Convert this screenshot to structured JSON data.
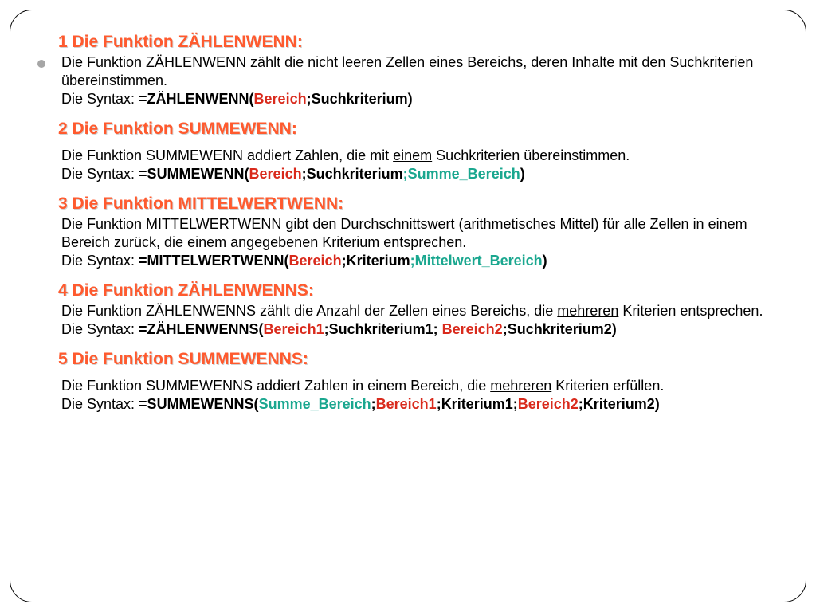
{
  "sections": [
    {
      "heading": "1 Die Funktion ZÄHLENWENN:",
      "desc_pre": "Die Funktion ZÄHLENWENN zählt die nicht leeren Zellen eines Bereichs,  deren Inhalte mit den Suchkriterien übereinstimmen.",
      "syntax_label": "Die Syntax: ",
      "syntax_lead": "=ZÄHLENWENN(",
      "p1": "Bereich",
      "sep1": ";",
      "p2": "Suchkriterium)",
      "tail": ""
    },
    {
      "heading": "2 Die Funktion SUMMEWENN:",
      "desc_pre": "Die Funktion SUMMEWENN addiert Zahlen, die mit ",
      "desc_u": "einem",
      "desc_post": " Suchkriterien übereinstimmen.",
      "syntax_label": "Die Syntax: ",
      "syntax_lead": "=SUMMEWENN(",
      "p1": "Bereich",
      "sep1": ";",
      "p2": "Suchkriterium",
      "sep2": ";",
      "p3": "Summe_Bereich",
      "tail": ")"
    },
    {
      "heading": "3 Die Funktion MITTELWERTWENN:",
      "desc_pre": "Die Funktion MITTELWERTWENN gibt den Durchschnittswert (arithmetisches Mittel) für alle Zellen in einem Bereich zurück, die einem angegebenen Kriterium entsprechen.",
      "syntax_label": "Die Syntax: ",
      "syntax_lead": "=MITTELWERTWENN(",
      "p1": "Bereich",
      "sep1": ";",
      "p2": "Kriterium",
      "sep2": ";",
      "p3": "Mittelwert_Bereich",
      "tail": ")"
    },
    {
      "heading": "4 Die Funktion ZÄHLENWENNS:",
      "desc_pre": "Die Funktion ZÄHLENWENNS zählt die Anzahl der Zellen eines Bereichs,  die ",
      "desc_u": "mehreren",
      "desc_post": " Kriterien entsprechen.",
      "syntax_label": "Die Syntax: ",
      "syntax_lead": "=ZÄHLENWENNS(",
      "p1": "Bereich1",
      "sep1": ";",
      "p2": "Suchkriterium1; ",
      "p3": "Bereich2",
      "sep2": ";",
      "p4": "Suchkriterium2)",
      "tail": ""
    },
    {
      "heading": "5 Die Funktion SUMMEWENNS:",
      "desc_pre": "Die Funktion SUMMEWENNS addiert Zahlen in einem Bereich, die ",
      "desc_u": "mehreren",
      "desc_post": " Kriterien erfüllen.",
      "syntax_label": "Die Syntax: ",
      "syntax_lead": "=SUMMEWENNS(",
      "p0": "Summe_Bereich",
      "sep0": ";",
      "p1": "Bereich1",
      "sep1": ";",
      "p2": "Kriterium1",
      "sep2": ";",
      "p3": "Bereich2",
      "sep3": ";",
      "p4": "Kriterium2)",
      "tail": ""
    }
  ]
}
